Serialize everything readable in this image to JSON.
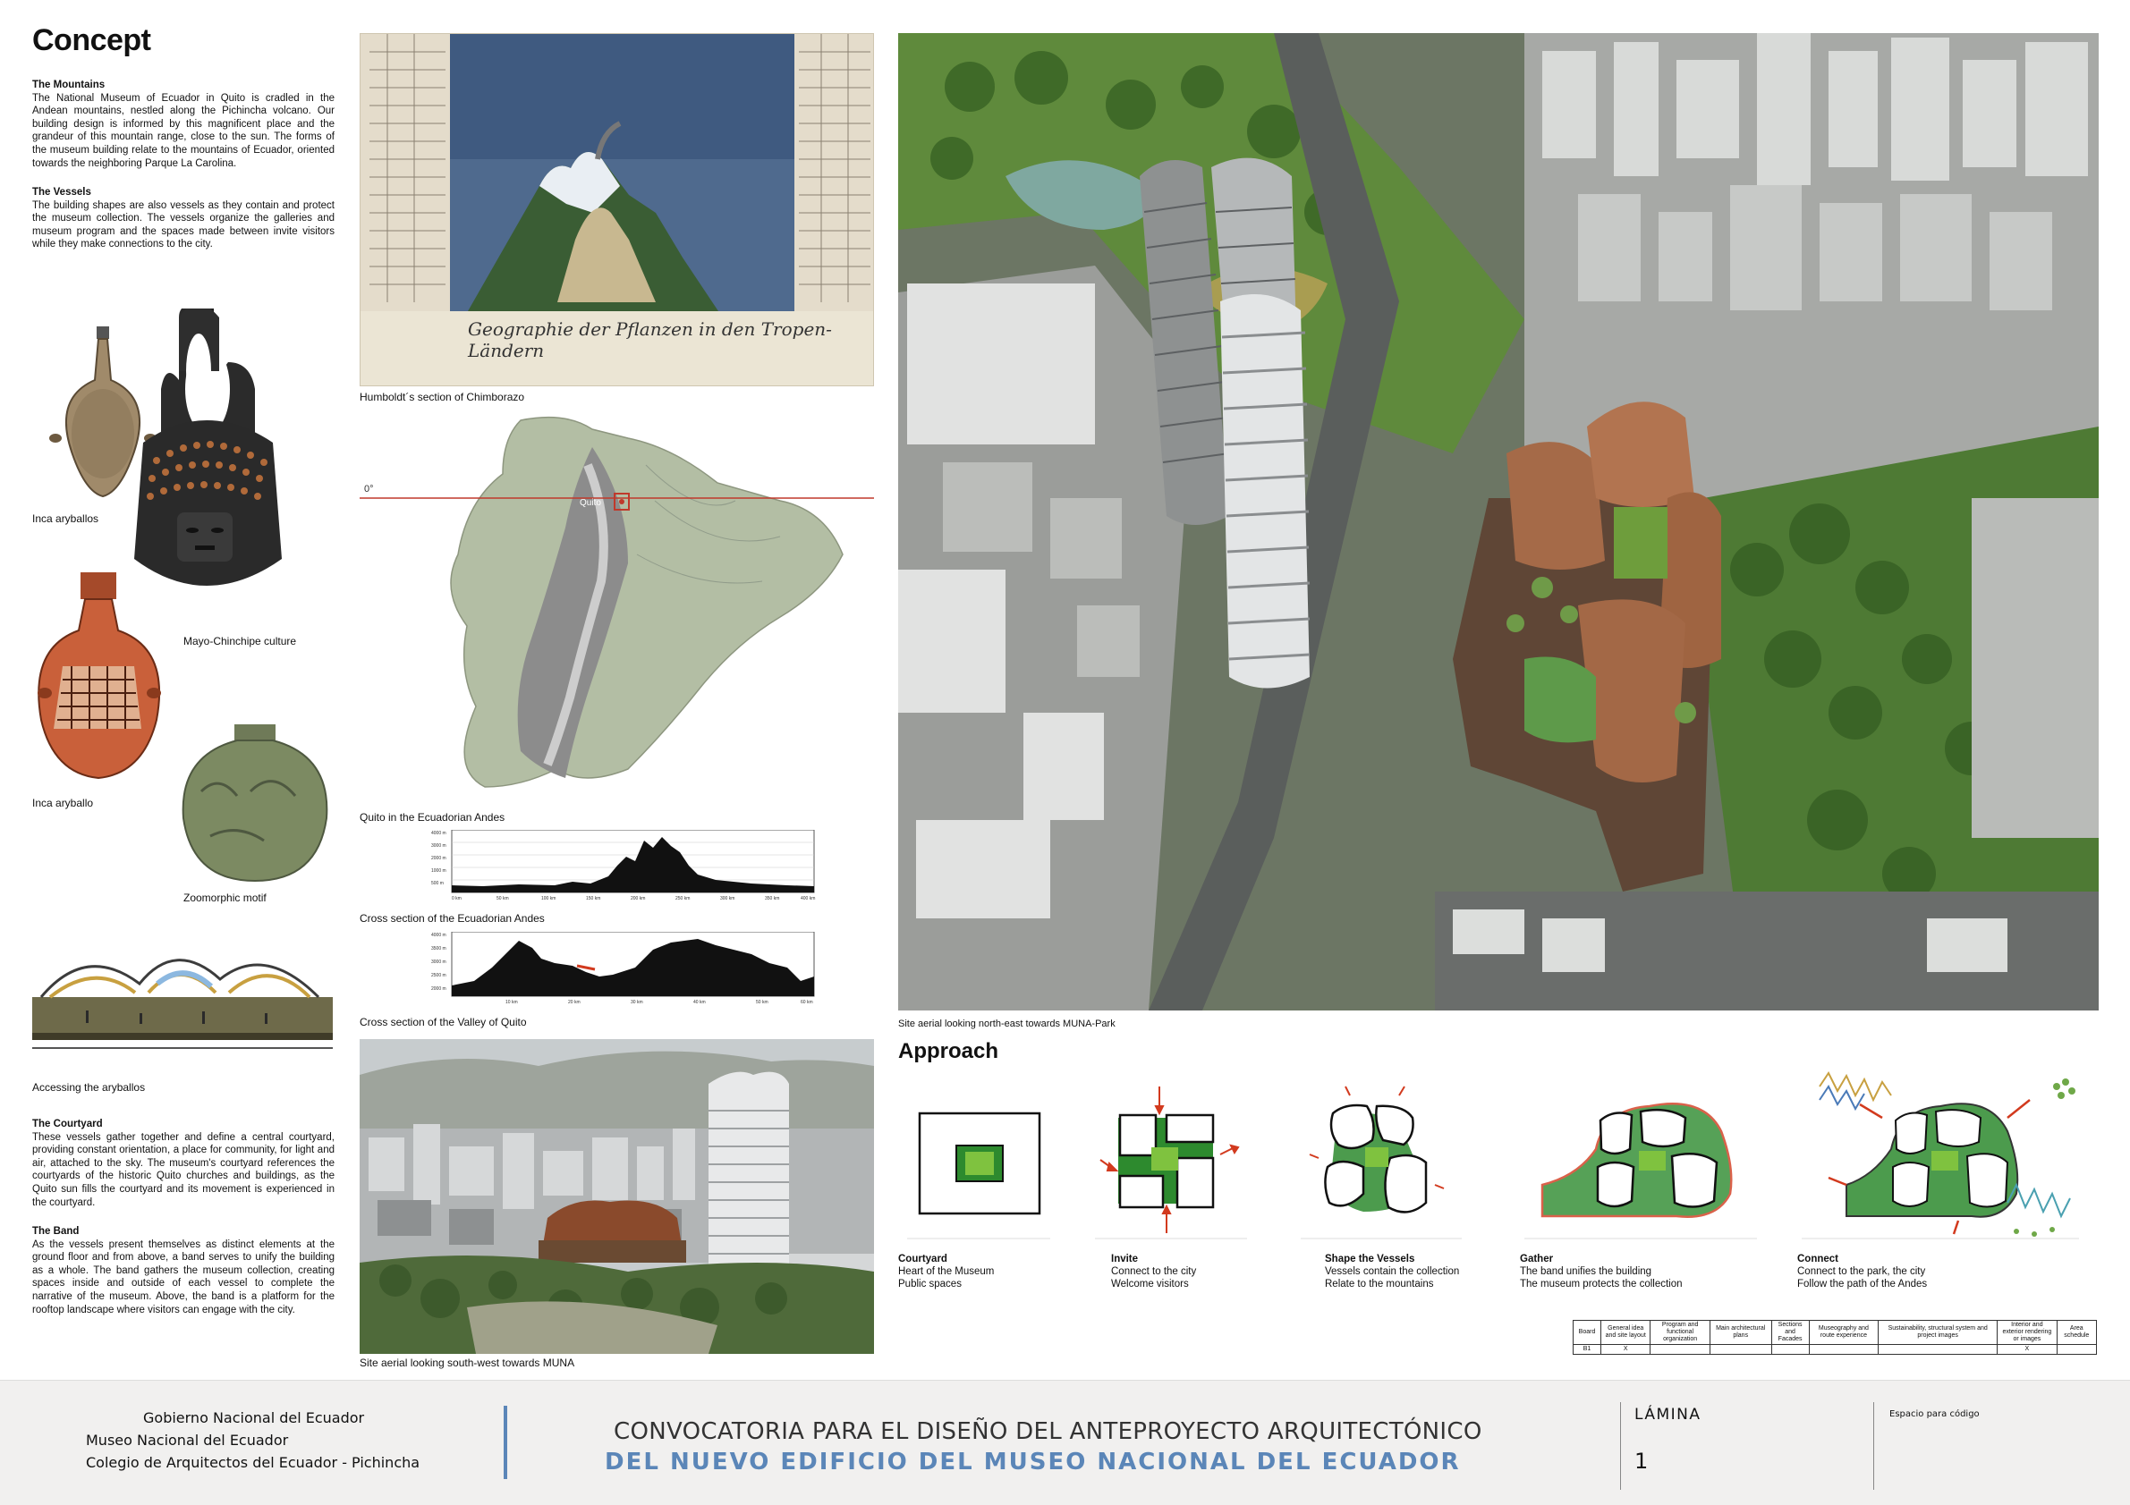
{
  "concept": {
    "title": "Concept",
    "mountains_heading": "The Mountains",
    "mountains_text": "The National Museum of Ecuador in Quito is cradled in the Andean mountains, nestled along the Pichincha volcano. Our building design is informed by this magnificent place and the grandeur of this mountain range, close to the sun. The forms of the museum building relate to the mountains of Ecuador, oriented towards the neighboring Parque La Carolina.",
    "vessels_heading": "The Vessels",
    "vessels_text": "The building shapes are also vessels as they contain and protect the museum collection. The vessels organize the galleries and museum program and the spaces made between invite visitors while they make connections to the city.",
    "courtyard_heading": "The Courtyard",
    "courtyard_text": "These vessels gather together and define a central courtyard, providing constant orientation, a place for community, for light and air, attached to the sky. The museum's courtyard references the courtyards of the historic Quito churches and buildings, as the Quito sun fills the courtyard and its movement is experienced in the courtyard.",
    "band_heading": "The Band",
    "band_text": "As the vessels present themselves as distinct elements at the ground floor and from above, a band serves to unify the building as a whole. The band gathers the museum collection, creating spaces inside and outside of each vessel to complete the narrative of the museum. Above, the band is a platform for the rooftop landscape where visitors can engage with the city."
  },
  "captions": {
    "inca_aryballos": "Inca aryballos",
    "mayo": "Mayo-Chinchipe culture",
    "inca_aryballo": "Inca aryballo",
    "zoomorphic": "Zoomorphic motif",
    "accessing": "Accessing the aryballos",
    "humboldt": "Humboldt´s section of Chimborazo",
    "quito_andes": "Quito in the Ecuadorian Andes",
    "cross_andes": "Cross section of the Ecuadorian Andes",
    "cross_valley": "Cross section of the Valley of Quito",
    "aerial_sw": "Site aerial looking south-west towards MUNA",
    "aerial_ne": "Site aerial looking north-east towards MUNA-Park"
  },
  "map": {
    "equator_label": "0°",
    "city_label": "Quito"
  },
  "humboldt_script": "Geographie der Pflanzen in den Tropen-Ländern",
  "approach": {
    "title": "Approach",
    "items": [
      {
        "title": "Courtyard",
        "line1": "Heart of the Museum",
        "line2": "Public spaces"
      },
      {
        "title": "Invite",
        "line1": "Connect to the city",
        "line2": "Welcome visitors"
      },
      {
        "title": "Shape the Vessels",
        "line1": "Vessels contain the collection",
        "line2": "Relate to the mountains"
      },
      {
        "title": "Gather",
        "line1": "The band unifies the building",
        "line2": "The museum protects the collection"
      },
      {
        "title": "Connect",
        "line1": "Connect to the park, the city",
        "line2": "Follow the path of the Andes"
      }
    ]
  },
  "schedule": {
    "headers": [
      "Board",
      "General idea and site layout",
      "Program and functional organization",
      "Main architectural plans",
      "Sections and Facades",
      "Museography and route experience",
      "Sustainability, structural system and project images",
      "Interior and exterior rendering or images",
      "Area schedule"
    ],
    "row": [
      "B1",
      "X",
      "",
      "",
      "",
      "",
      "",
      "X",
      ""
    ]
  },
  "footer": {
    "org1": "Gobierno Nacional del Ecuador",
    "org2": "Museo Nacional del Ecuador",
    "org3": "Colegio de Arquitectos del Ecuador - Pichincha",
    "title1": "CONVOCATORIA PARA EL DISEÑO DEL ANTEPROYECTO ARQUITECTÓNICO",
    "title2": "DEL NUEVO EDIFICIO DEL MUSEO NACIONAL DEL ECUADOR",
    "lamina_label": "LÁMINA",
    "lamina_number": "1",
    "code_label": "Espacio para código"
  },
  "colors": {
    "accent_blue": "#5b86b8",
    "green": "#1f7a2e",
    "red": "#d23a1e"
  }
}
